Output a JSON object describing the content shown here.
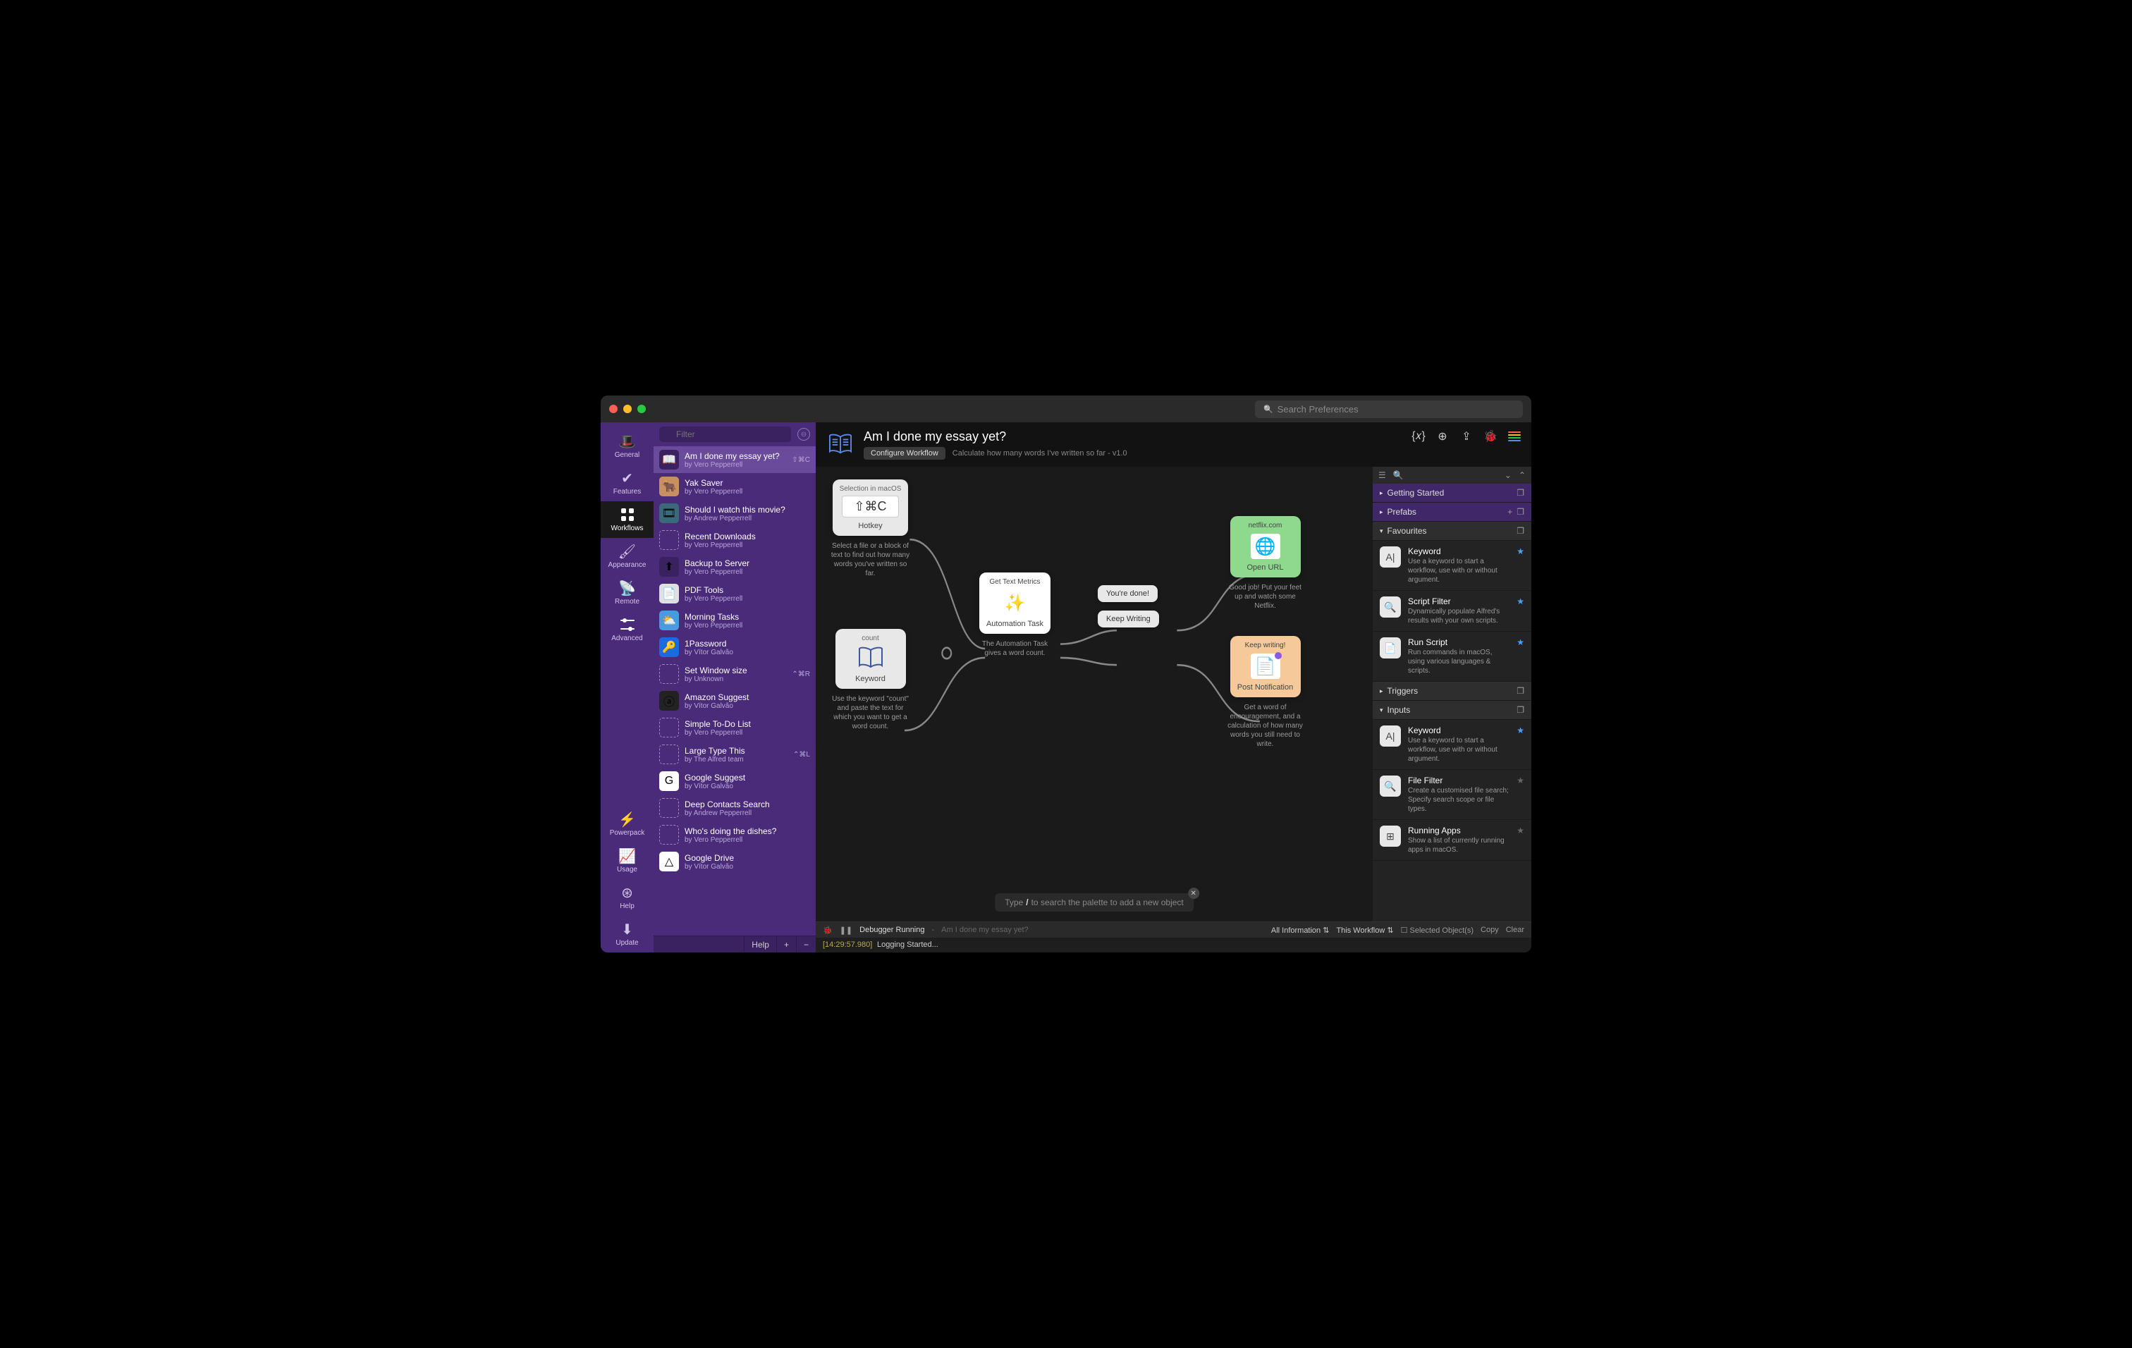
{
  "titlebar": {
    "search_placeholder": "Search Preferences"
  },
  "nav": [
    {
      "id": "general",
      "label": "General",
      "icon": "☁"
    },
    {
      "id": "features",
      "label": "Features",
      "icon": "✔"
    },
    {
      "id": "workflows",
      "label": "Workflows",
      "icon": "▦"
    },
    {
      "id": "appearance",
      "label": "Appearance",
      "icon": "🖌"
    },
    {
      "id": "remote",
      "label": "Remote",
      "icon": "📡"
    },
    {
      "id": "advanced",
      "label": "Advanced",
      "icon": "⚙"
    }
  ],
  "nav_bottom": [
    {
      "id": "powerpack",
      "label": "Powerpack",
      "icon": "⚡"
    },
    {
      "id": "usage",
      "label": "Usage",
      "icon": "📈"
    },
    {
      "id": "help",
      "label": "Help",
      "icon": "⊛"
    },
    {
      "id": "update",
      "label": "Update",
      "icon": "⬇"
    }
  ],
  "filter": {
    "placeholder": "Filter"
  },
  "workflows": [
    {
      "title": "Am I done my essay yet?",
      "author": "by Vero Pepperrell",
      "shortcut": "⇧⌘C",
      "selected": true,
      "icon_type": "book"
    },
    {
      "title": "Yak Saver",
      "author": "by Vero Pepperrell",
      "icon_type": "image",
      "icon_bg": "#c89060"
    },
    {
      "title": "Should I watch this movie?",
      "author": "by Andrew Pepperrell",
      "icon_type": "reel",
      "icon_bg": "#3a6a7a"
    },
    {
      "title": "Recent Downloads",
      "author": "by Vero Pepperrell",
      "icon_type": "dotted"
    },
    {
      "title": "Backup to Server",
      "author": "by Vero Pepperrell",
      "icon_type": "upload",
      "icon_bg": "#3a2260"
    },
    {
      "title": "PDF Tools",
      "author": "by Vero Pepperrell",
      "icon_type": "pdf",
      "icon_bg": "#e0e0e0"
    },
    {
      "title": "Morning Tasks",
      "author": "by Vero Pepperrell",
      "icon_type": "weather",
      "icon_bg": "#4a9ae0"
    },
    {
      "title": "1Password",
      "author": "by Vítor Galvão",
      "icon_type": "1p",
      "icon_bg": "#1a6ae0"
    },
    {
      "title": "Set Window size",
      "author": "by Unknown",
      "shortcut": "⌃⌘R",
      "icon_type": "dotted"
    },
    {
      "title": "Amazon Suggest",
      "author": "by Vítor Galvão",
      "icon_type": "amazon",
      "icon_bg": "#222"
    },
    {
      "title": "Simple To-Do List",
      "author": "by Vero Pepperrell",
      "icon_type": "dotted"
    },
    {
      "title": "Large Type This",
      "author": "by The Alfred team",
      "shortcut": "⌃⌘L",
      "icon_type": "dotted"
    },
    {
      "title": "Google Suggest",
      "author": "by Vítor Galvão",
      "icon_type": "google",
      "icon_bg": "#fff"
    },
    {
      "title": "Deep Contacts Search",
      "author": "by Andrew Pepperrell",
      "icon_type": "dotted"
    },
    {
      "title": "Who's doing the dishes?",
      "author": "by Vero Pepperrell",
      "icon_type": "dotted"
    },
    {
      "title": "Google Drive",
      "author": "by Vítor Galvão",
      "icon_type": "gdrive",
      "icon_bg": "#fff"
    }
  ],
  "wf_footer": {
    "help": "Help",
    "add": "+",
    "remove": "−"
  },
  "header": {
    "title": "Am I done my essay yet?",
    "config_button": "Configure Workflow",
    "description": "Calculate how many words I've written so far - v1.0"
  },
  "canvas": {
    "hotkey": {
      "caption": "Selection in macOS",
      "keys": "⇧⌘C",
      "label": "Hotkey",
      "desc": "Select a file or a block of text to find out how many words you've written so far."
    },
    "keyword": {
      "caption": "count",
      "label": "Keyword",
      "desc": "Use the keyword \"count\" and paste the text for which you want to get a word count."
    },
    "automation": {
      "caption": "Get Text Metrics",
      "label": "Automation Task",
      "desc": "The Automation Task gives a word count."
    },
    "done": {
      "text": "You're done!"
    },
    "keep": {
      "text": "Keep Writing"
    },
    "openurl": {
      "caption": "netflix.com",
      "label": "Open URL",
      "desc": "Good job! Put your feet up and watch some Netflix."
    },
    "notify": {
      "caption": "Keep writing!",
      "label": "Post Notification",
      "desc": "Get a word of encouragement, and a calculation of how many words you still need to write."
    },
    "search_prefix": "Type ",
    "search_slash": "/",
    "search_rest": " to search the palette to add a new object"
  },
  "panel": {
    "sections": {
      "getting_started": "Getting Started",
      "prefabs": "Prefabs",
      "favourites": "Favourites",
      "triggers": "Triggers",
      "inputs": "Inputs"
    },
    "fav_items": [
      {
        "title": "Keyword",
        "desc": "Use a keyword to start a workflow, use with or without argument.",
        "icon": "A|",
        "star": "blue"
      },
      {
        "title": "Script Filter",
        "desc": "Dynamically populate Alfred's results with your own scripts.",
        "icon": "🔍",
        "star": "blue"
      },
      {
        "title": "Run Script",
        "desc": "Run commands in macOS, using various languages & scripts.",
        "icon": "📄",
        "star": "blue"
      }
    ],
    "input_items": [
      {
        "title": "Keyword",
        "desc": "Use a keyword to start a workflow, use with or without argument.",
        "icon": "A|",
        "star": "blue"
      },
      {
        "title": "File Filter",
        "desc": "Create a customised file search; Specify search scope or file types.",
        "icon": "🔍",
        "star": "gray"
      },
      {
        "title": "Running Apps",
        "desc": "Show a list of currently running apps in macOS.",
        "icon": "⊞",
        "star": "gray"
      }
    ]
  },
  "debugger": {
    "status": "Debugger Running",
    "workflow": "Am I done my essay yet?",
    "info_sel": "All Information",
    "scope_sel": "This Workflow",
    "selected": "Selected Object(s)",
    "copy": "Copy",
    "clear": "Clear",
    "timestamp": "[14:29:57.980]",
    "message": "Logging Started..."
  }
}
